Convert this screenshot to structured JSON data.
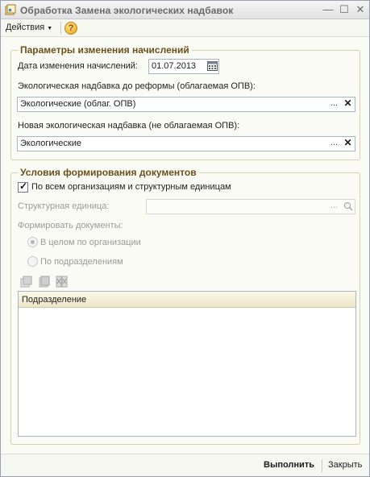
{
  "window": {
    "title": "Обработка  Замена экологических надбавок",
    "controls": {
      "minimize": "—",
      "maximize": "☐",
      "close": "✕"
    }
  },
  "toolbar": {
    "actions_label": "Действия",
    "actions_arrow": "▼",
    "help_label": "?"
  },
  "accrual_params": {
    "title": "Параметры изменения начислений",
    "date_label": "Дата изменения начислений:",
    "date_value": "01.07.2013",
    "old_bonus_label": "Экологическая надбавка до реформы (облагаемая ОПВ):",
    "old_bonus_value": "Экологические (облаг. ОПВ)",
    "new_bonus_label": "Новая экологическая надбавка (не облагаемая ОПВ):",
    "new_bonus_value": "Экологические",
    "select_btn": "...",
    "clear_btn": "✕"
  },
  "doc_conditions": {
    "title": "Условия формирования документов",
    "all_orgs_label": "По всем организациям и структурным единицам",
    "all_orgs_checked": true,
    "struct_unit_label": "Структурная единица:",
    "struct_unit_value": "",
    "form_docs_label": "Формировать документы:",
    "radio_org_label": "В целом по организации",
    "radio_dept_label": "По подразделениям",
    "selected_radio": "В целом по организации"
  },
  "table": {
    "columns": [
      "Подразделение"
    ],
    "rows": []
  },
  "footer": {
    "execute_label": "Выполнить",
    "close_label": "Закрыть"
  },
  "colors": {
    "group_title": "#6b4f1d",
    "window_bg": "#fbfbf5",
    "field_border": "#a8b4c4"
  }
}
